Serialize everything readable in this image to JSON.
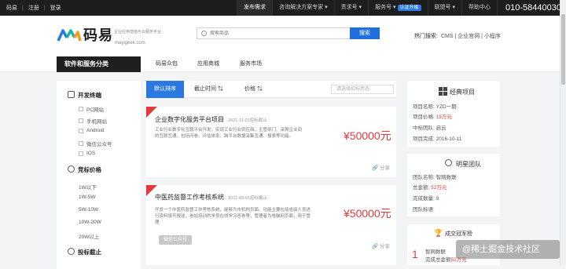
{
  "topbar": {
    "left_links": [
      "码易",
      "注册",
      "登录"
    ],
    "publish": "发布需求",
    "consult": "咨询解决方案专家",
    "jobs": "责求号",
    "service": "服务号",
    "cert_badge": "认证升级",
    "contact": "联盟号",
    "help": "帮助中心",
    "phone": "010-58440030"
  },
  "header": {
    "logo_name": "码易",
    "logo_sub": "企业应用增值与云服务平台",
    "logo_url": "mayigeek.com",
    "search_placeholder": "搜索商品",
    "search_btn": "搜索",
    "hot_label": "热门搜索:",
    "hot_items": "CMS | 企业官网 | 小程序"
  },
  "nav": {
    "category_title": "软件和服务分类",
    "items": [
      "码易众包",
      "应用商城",
      "服务市场"
    ]
  },
  "filters": {
    "terminal_title": "开发终端",
    "terminals": [
      "PC网站",
      "手机网站",
      "Android",
      "微信公众号",
      "IOS"
    ],
    "price_title": "竞标价格",
    "prices": [
      "1W以下",
      "1W-5W",
      "5W-10W",
      "10W-20W",
      "20W以上"
    ],
    "deadline_title": "投标截止"
  },
  "tabs": {
    "active": "默认排序",
    "deadline": "截止时间",
    "price": "价格",
    "status_placeholder": "请选择招标状态"
  },
  "projects": [
    {
      "title": "企业数字化服务平台项目",
      "date": "2021-11-01招标截止",
      "desc": "工业行业数字化互联平台开发。实现工业行业供应商、主管部门、采购企业间的互联互通。包括问卷、评估体系、跨平台数据采集互通、报表等功能。",
      "price": "¥50000元",
      "share": "分享"
    },
    {
      "title": "中医药监督工作考核系统",
      "date": "2021-09-01招标截止",
      "desc": "开发一个中医药监督工作考核系统，能够为市机构页面、功能主要包括省级人员进行资料填写报送，参加培训的学员在线学习答卷等，管理者为电脑网页面，用于管理",
      "price": "¥50000元",
      "tag": "微信公众号",
      "share": "分享"
    }
  ],
  "classic": {
    "title": "经典项目",
    "rows": [
      {
        "k": "项目名称:",
        "v": "YZD一期"
      },
      {
        "k": "项目价格:",
        "v": "15万元"
      },
      {
        "k": "中标团队:",
        "v": "启云"
      },
      {
        "k": "项目完成:",
        "v": "2016-10-11"
      }
    ]
  },
  "star_team": {
    "title": "明星团队",
    "rows": [
      {
        "k": "团队名称:",
        "v": "智网数联"
      },
      {
        "k": "总金额:",
        "v": "52万元"
      },
      {
        "k": "完成数量:",
        "v": "9"
      },
      {
        "k": "团队标语:",
        "v": ""
      }
    ]
  },
  "champion": {
    "title": "成交冠军榜",
    "rank": "1",
    "name": "智网数联",
    "amount_label": "完成总金额",
    "amount": "52万元"
  },
  "watermark": "@稀土掘金技术社区",
  "colors": {
    "accent": "#2b79e0",
    "price_red": "#e4393c",
    "dark": "#1d1d1d"
  }
}
